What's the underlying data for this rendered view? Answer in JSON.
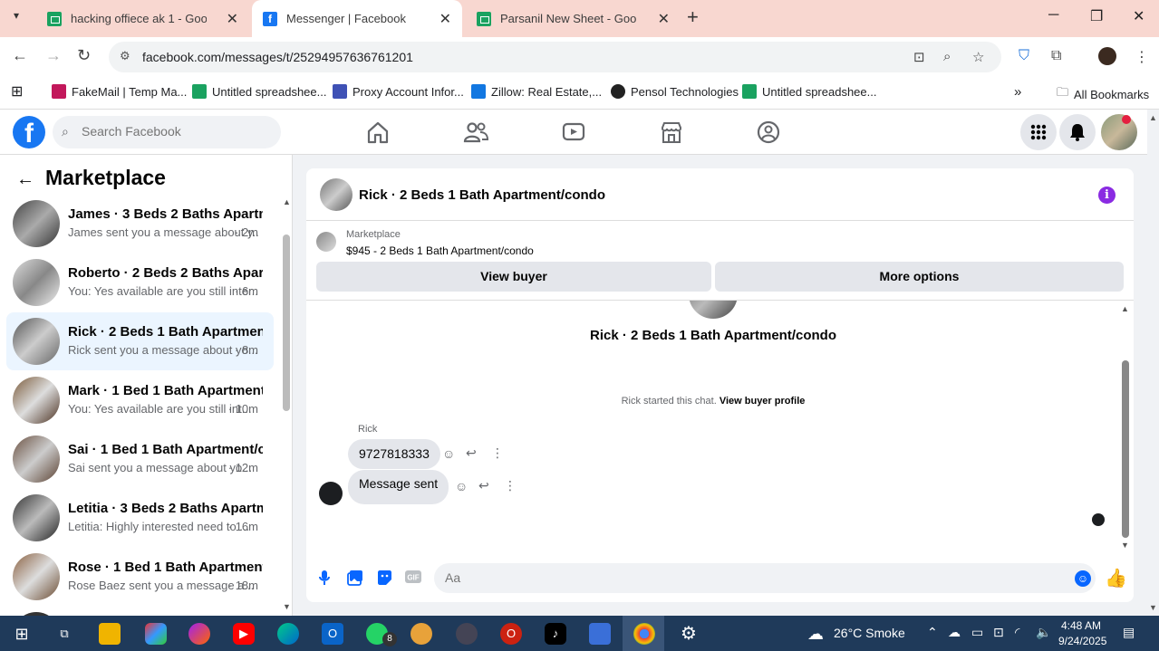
{
  "browser": {
    "tabs": [
      {
        "title": "hacking offiece ak 1 - Google Sh",
        "icon": "sheets-icon"
      },
      {
        "title": "Messenger | Facebook",
        "icon": "facebook-icon"
      },
      {
        "title": "Parsanil New Sheet - Google Sh",
        "icon": "sheets-icon"
      }
    ],
    "url": "facebook.com/messages/t/25294957636761201",
    "bookmarks": [
      "FakeMail | Temp Ma...",
      "Untitled spreadshee...",
      "Proxy Account Infor...",
      "Zillow: Real Estate,...",
      "Pensol Technologies",
      "Untitled spreadshee..."
    ],
    "all_bookmarks": "All Bookmarks"
  },
  "facebook": {
    "search_placeholder": "Search Facebook",
    "logo": "f"
  },
  "left_panel": {
    "title": "Marketplace",
    "conversations": [
      {
        "name": "James · 3 Beds 2 Baths Apartme...",
        "preview": "James sent you a message about y...",
        "time": "· 2m"
      },
      {
        "name": "Roberto · 2 Beds 2 Baths Apart...",
        "preview": "You: Yes available are you still inter...",
        "time": "· 6m"
      },
      {
        "name": "Rick · 2 Beds 1 Bath Apartment/...",
        "preview": "Rick sent you a message about yo...",
        "time": "· 8m"
      },
      {
        "name": "Mark · 1 Bed 1 Bath Apartment/...",
        "preview": "You: Yes available are you still int...",
        "time": "· 10m"
      },
      {
        "name": "Sai · 1 Bed 1 Bath Apartment/co...",
        "preview": "Sai sent you a message about yo...",
        "time": "· 12m"
      },
      {
        "name": "Letitia · 3 Beds 2 Baths Apartme...",
        "preview": "Letitia: Highly interested need to ...",
        "time": "· 16m"
      },
      {
        "name": "Rose · 1 Bed 1 Bath Apartment/c...",
        "preview": "Rose Baez sent you a message a...",
        "time": "· 18m"
      }
    ]
  },
  "chat": {
    "title": "Rick · 2 Beds 1 Bath Apartment/condo",
    "marketplace_label": "Marketplace",
    "listing": "$945 - 2 Beds 1 Bath Apartment/condo",
    "view_buyer": "View buyer",
    "more_options": "More options",
    "big_name": "Rick · 2 Beds 1 Bath Apartment/condo",
    "started_text": "Rick started this chat.",
    "view_buyer_profile": "View buyer profile",
    "sender": "Rick",
    "messages": [
      {
        "text": "9727818333",
        "from": "Rick"
      },
      {
        "text": "Message sent",
        "from": "me"
      }
    ],
    "composer_placeholder": "Aa"
  },
  "taskbar": {
    "weather": "26°C  Smoke",
    "time": "4:48 AM",
    "date": "9/24/2025",
    "whatsapp_badge": "8"
  },
  "colors": {
    "fb_blue": "#1877f2",
    "messenger_blue": "#0866ff",
    "tab_strip": "#f8d7d0",
    "active_conv": "#ebf5ff",
    "info_purple": "#8a2be2"
  }
}
